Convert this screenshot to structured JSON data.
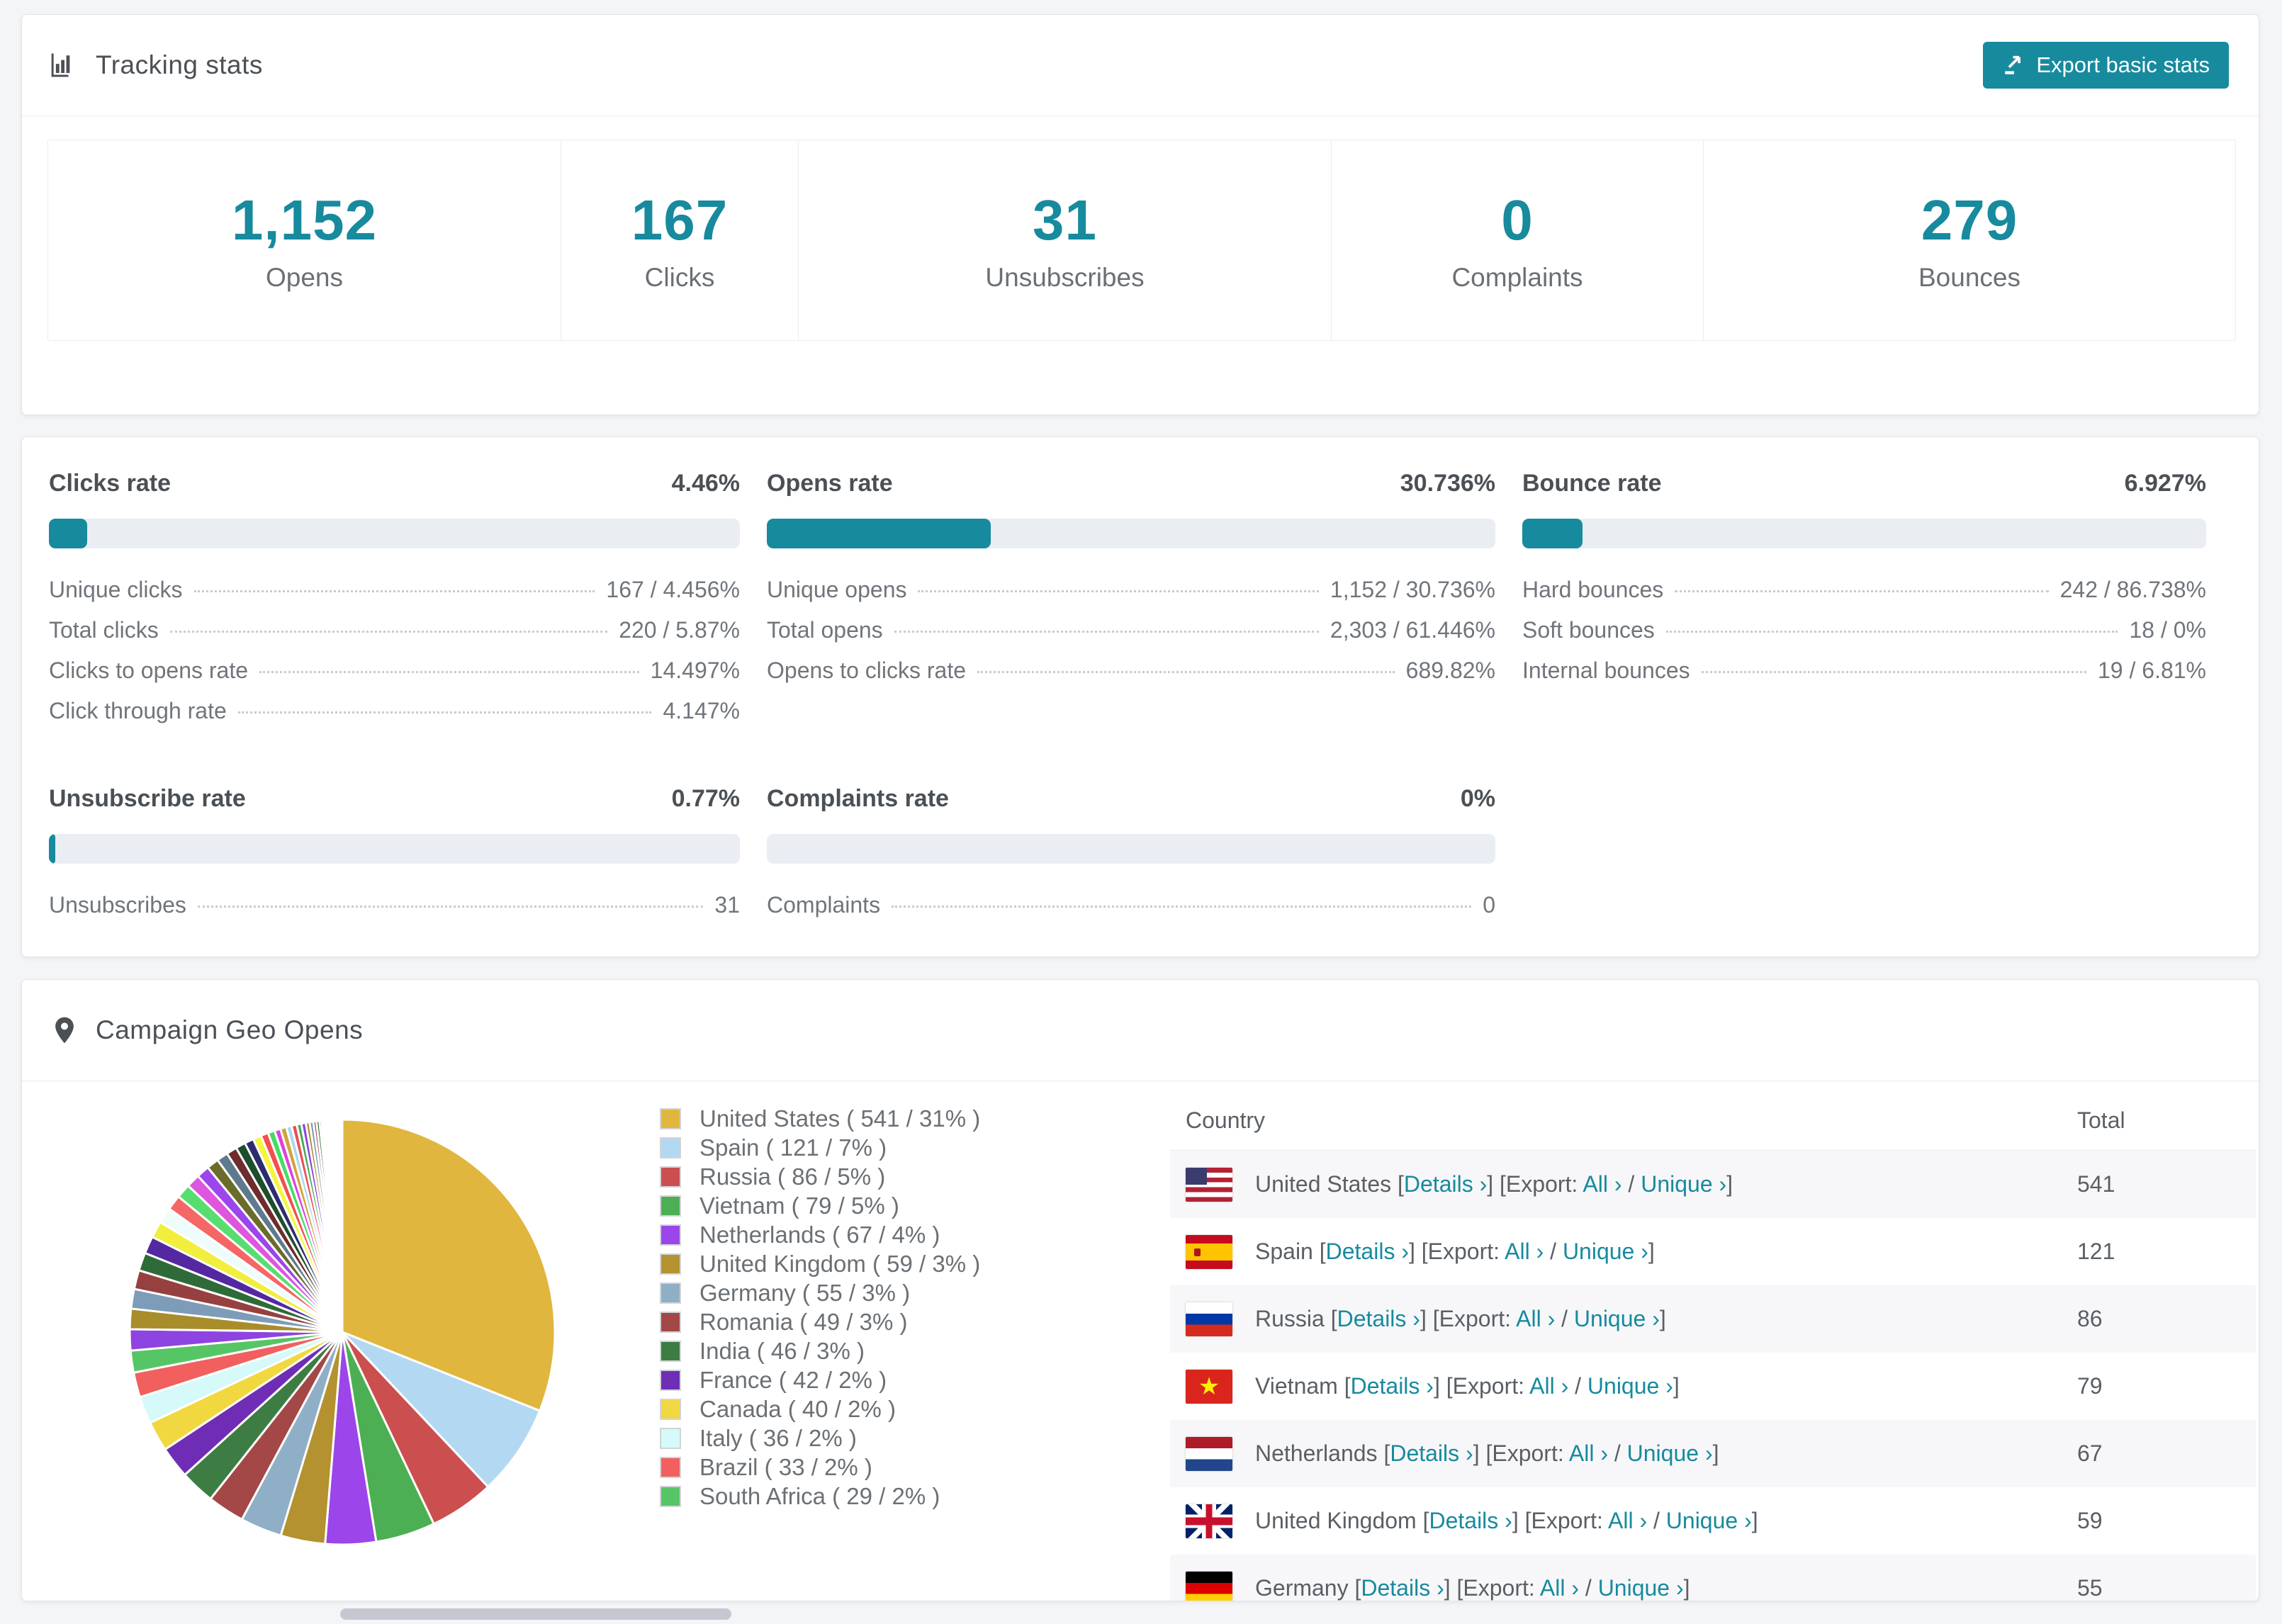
{
  "colors": {
    "accent": "#178a9e",
    "bar_track": "#eaedf2",
    "panel_border": "#e3e5ea"
  },
  "tracking": {
    "title": "Tracking stats",
    "header_icon": "bar-chart-icon",
    "export_button": "Export basic stats",
    "cards": [
      {
        "value": "1,152",
        "label": "Opens"
      },
      {
        "value": "167",
        "label": "Clicks"
      },
      {
        "value": "31",
        "label": "Unsubscribes"
      },
      {
        "value": "0",
        "label": "Complaints"
      },
      {
        "value": "279",
        "label": "Bounces"
      }
    ]
  },
  "rates": [
    {
      "title": "Clicks rate",
      "value": "4.46%",
      "bar_pct": 5.5,
      "rows": [
        {
          "label": "Unique clicks",
          "value": "167 / 4.456%"
        },
        {
          "label": "Total clicks",
          "value": "220 / 5.87%"
        },
        {
          "label": "Clicks to opens rate",
          "value": "14.497%"
        },
        {
          "label": "Click through rate",
          "value": "4.147%"
        }
      ]
    },
    {
      "title": "Opens rate",
      "value": "30.736%",
      "bar_pct": 30.7,
      "rows": [
        {
          "label": "Unique opens",
          "value": "1,152 / 30.736%"
        },
        {
          "label": "Total opens",
          "value": "2,303 / 61.446%"
        },
        {
          "label": "Opens to clicks rate",
          "value": "689.82%"
        }
      ]
    },
    {
      "title": "Bounce rate",
      "value": "6.927%",
      "bar_pct": 8.8,
      "rows": [
        {
          "label": "Hard bounces",
          "value": "242 / 86.738%"
        },
        {
          "label": "Soft bounces",
          "value": "18 / 0%"
        },
        {
          "label": "Internal bounces",
          "value": "19 / 6.81%"
        }
      ]
    },
    {
      "title": "Unsubscribe rate",
      "value": "0.77%",
      "bar_pct": 0.9,
      "rows": [
        {
          "label": "Unsubscribes",
          "value": "31"
        }
      ]
    },
    {
      "title": "Complaints rate",
      "value": "0%",
      "bar_pct": 0,
      "rows": [
        {
          "label": "Complaints",
          "value": "0"
        }
      ]
    }
  ],
  "geo": {
    "title": "Campaign Geo Opens",
    "header_icon": "map-pin-icon",
    "chart_data": {
      "type": "pie",
      "title": "Campaign Geo Opens",
      "legend_position": "right-of-pie",
      "start_angle_deg": -90,
      "direction": "clockwise",
      "slices": [
        {
          "label": "United States",
          "value": 541,
          "pct": "31%",
          "color": "#e0b63e"
        },
        {
          "label": "Spain",
          "value": 121,
          "pct": "7%",
          "color": "#b3d9f2"
        },
        {
          "label": "Russia",
          "value": 86,
          "pct": "5%",
          "color": "#cc4f4f"
        },
        {
          "label": "Vietnam",
          "value": 79,
          "pct": "5%",
          "color": "#4caf53"
        },
        {
          "label": "Netherlands",
          "value": 67,
          "pct": "4%",
          "color": "#9b45ea"
        },
        {
          "label": "United Kingdom",
          "value": 59,
          "pct": "3%",
          "color": "#b3922f"
        },
        {
          "label": "Germany",
          "value": 55,
          "pct": "3%",
          "color": "#8fafc6"
        },
        {
          "label": "Romania",
          "value": 49,
          "pct": "3%",
          "color": "#a34747"
        },
        {
          "label": "India",
          "value": 46,
          "pct": "3%",
          "color": "#3d7d44"
        },
        {
          "label": "France",
          "value": 42,
          "pct": "2%",
          "color": "#6f2db5"
        },
        {
          "label": "Canada",
          "value": 40,
          "pct": "2%",
          "color": "#f2d840"
        },
        {
          "label": "Italy",
          "value": 36,
          "pct": "2%",
          "color": "#d6f9f9"
        },
        {
          "label": "Brazil",
          "value": 33,
          "pct": "2%",
          "color": "#f15f5f"
        },
        {
          "label": "South Africa",
          "value": 29,
          "pct": "2%",
          "color": "#55c565"
        }
      ],
      "others_unlabeled": {
        "note": "remaining small slices shown in pie fan without legend entries",
        "values": [
          28,
          27,
          26,
          25,
          24,
          23,
          22,
          21,
          20,
          19,
          18,
          17,
          16,
          15,
          14,
          13,
          12,
          11,
          10,
          9,
          8,
          8,
          7,
          7,
          6,
          6,
          5,
          5,
          4,
          4,
          3,
          3,
          3,
          2,
          2,
          2,
          2,
          1,
          1,
          1,
          1,
          1,
          1,
          1,
          1,
          1,
          1,
          1,
          1,
          1
        ],
        "colors": [
          "#8e44e0",
          "#a98d2b",
          "#7d9cb8",
          "#96403f",
          "#2f6b38",
          "#5428a0",
          "#f2ee3e",
          "#eefcfc",
          "#f56666",
          "#57dd70",
          "#de55de",
          "#9b45ea",
          "#6b6b2a",
          "#5d7a8e",
          "#6e2c2c",
          "#1e4e2c",
          "#2c2c6e",
          "#f5f540",
          "#f54e4e",
          "#42dd62",
          "#dd42dd",
          "#d0a43a",
          "#aad6f2",
          "#e85050",
          "#44a754"
        ]
      }
    },
    "table": {
      "headers": {
        "country": "Country",
        "total": "Total"
      },
      "links": {
        "bracket_open": "[",
        "bracket_close": "]",
        "details": "Details ›",
        "export_label": "Export:",
        "all": "All ›",
        "separator": "/",
        "unique": "Unique ›"
      },
      "rows": [
        {
          "flag": "us",
          "country": "United States",
          "total": "541"
        },
        {
          "flag": "es",
          "country": "Spain",
          "total": "121"
        },
        {
          "flag": "ru",
          "country": "Russia",
          "total": "86"
        },
        {
          "flag": "vn",
          "country": "Vietnam",
          "total": "79"
        },
        {
          "flag": "nl",
          "country": "Netherlands",
          "total": "67"
        },
        {
          "flag": "gb",
          "country": "United Kingdom",
          "total": "59"
        },
        {
          "flag": "de",
          "country": "Germany",
          "total": "55"
        }
      ]
    }
  }
}
